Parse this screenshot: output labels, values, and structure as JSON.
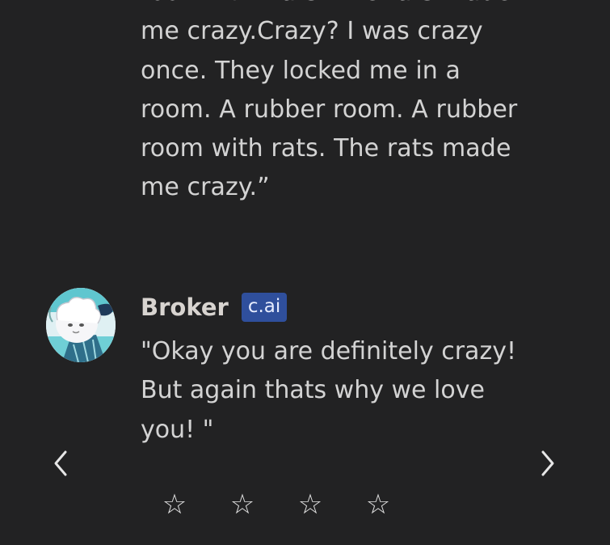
{
  "previous_message": {
    "lines": [
      "room with rats. The rats made",
      "me crazy.Crazy? I was crazy",
      "once. They locked me in a",
      "room. A rubber room. A rubber",
      "room with rats. The rats made",
      "me crazy.”"
    ]
  },
  "reply": {
    "sender": "Broker",
    "badge": "c.ai",
    "lines": [
      "\"Okay you are definitely crazy!",
      "But again thats why we love",
      "you! \""
    ]
  },
  "navigation": {
    "prev_icon": "chevron-left-icon",
    "next_icon": "chevron-right-icon"
  },
  "rating": {
    "stars": [
      "☆",
      "☆",
      "☆",
      "☆"
    ],
    "value": 0
  },
  "colors": {
    "background": "#222223",
    "text": "#d3d3d3",
    "badge": "#2f4f9c"
  }
}
